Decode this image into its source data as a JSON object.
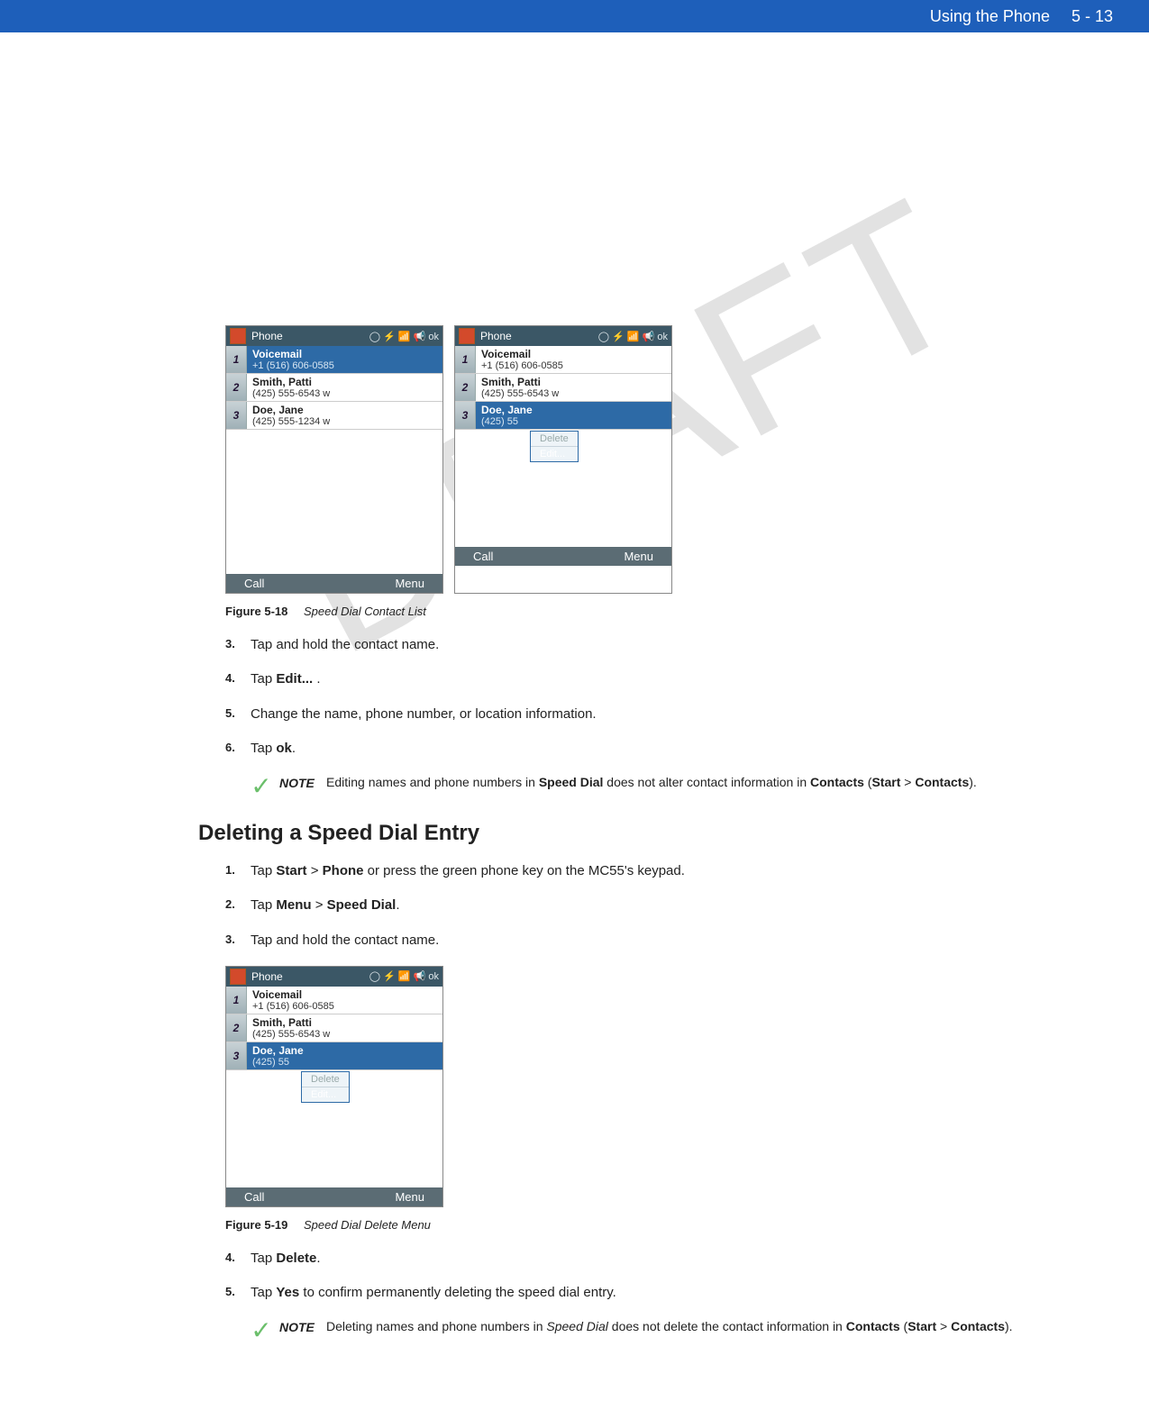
{
  "header": {
    "chapter": "Using the Phone",
    "page": "5 - 13"
  },
  "watermark": "DRAFT",
  "phoneA": {
    "title": "Phone",
    "status": "◯ ⚡ 📶 📢 ok",
    "rows": [
      {
        "n": "1",
        "name": "Voicemail",
        "num": "+1 (516) 606-0585",
        "sel": true
      },
      {
        "n": "2",
        "name": "Smith, Patti",
        "num": "(425) 555-6543 w"
      },
      {
        "n": "3",
        "name": "Doe, Jane",
        "num": "(425) 555-1234 w"
      }
    ],
    "left": "Call",
    "right": "Menu"
  },
  "phoneB": {
    "title": "Phone",
    "status": "◯ ⚡ 📶 📢 ok",
    "rows": [
      {
        "n": "1",
        "name": "Voicemail",
        "num": "+1 (516) 606-0585"
      },
      {
        "n": "2",
        "name": "Smith, Patti",
        "num": "(425) 555-6543 w"
      },
      {
        "n": "3",
        "name": "Doe, Jane",
        "num": "(425) 55",
        "sel": true
      }
    ],
    "ctx": {
      "del": "Delete",
      "edit": "Edit..."
    },
    "left": "Call",
    "right": "Menu"
  },
  "phoneC": {
    "title": "Phone",
    "status": "◯ ⚡ 📶 📢 ok",
    "rows": [
      {
        "n": "1",
        "name": "Voicemail",
        "num": "+1 (516) 606-0585"
      },
      {
        "n": "2",
        "name": "Smith, Patti",
        "num": "(425) 555-6543 w"
      },
      {
        "n": "3",
        "name": "Doe, Jane",
        "num": "(425) 55",
        "sel": true
      }
    ],
    "ctx": {
      "del": "Delete",
      "edit": "Edit..."
    },
    "left": "Call",
    "right": "Menu"
  },
  "fig18": {
    "label": "Figure 5-18",
    "desc": "Speed Dial Contact List"
  },
  "fig19": {
    "label": "Figure 5-19",
    "desc": "Speed Dial Delete Menu"
  },
  "stepsA": [
    {
      "n": "3.",
      "html": "Tap and hold the contact name."
    },
    {
      "n": "4.",
      "html": "Tap <b>Edit...</b> ."
    },
    {
      "n": "5.",
      "html": "Change the name, phone number, or location information."
    },
    {
      "n": "6.",
      "html": "Tap <b>ok</b>."
    }
  ],
  "note1": {
    "label": "NOTE",
    "html": "Editing names and phone numbers in <b>Speed Dial</b> does not alter contact information in <b>Contacts</b> (<b>Start</b> > <b>Contacts</b>)."
  },
  "subheading": "Deleting a Speed Dial Entry",
  "stepsB": [
    {
      "n": "1.",
      "html": "Tap <b>Start</b> > <b>Phone</b> or press the green phone key on the MC55's keypad."
    },
    {
      "n": "2.",
      "html": "Tap <b>Menu</b> > <b>Speed Dial</b>."
    },
    {
      "n": "3.",
      "html": "Tap and hold the contact name."
    }
  ],
  "stepsC": [
    {
      "n": "4.",
      "html": "Tap <b>Delete</b>."
    },
    {
      "n": "5.",
      "html": "Tap <b>Yes</b> to confirm permanently deleting the speed dial entry."
    }
  ],
  "note2": {
    "label": "NOTE",
    "html": "Deleting names and phone numbers in <i>Speed Dial</i> does not delete the contact information in <b>Contacts</b> (<b>Start</b> > <b>Contacts</b>)."
  }
}
